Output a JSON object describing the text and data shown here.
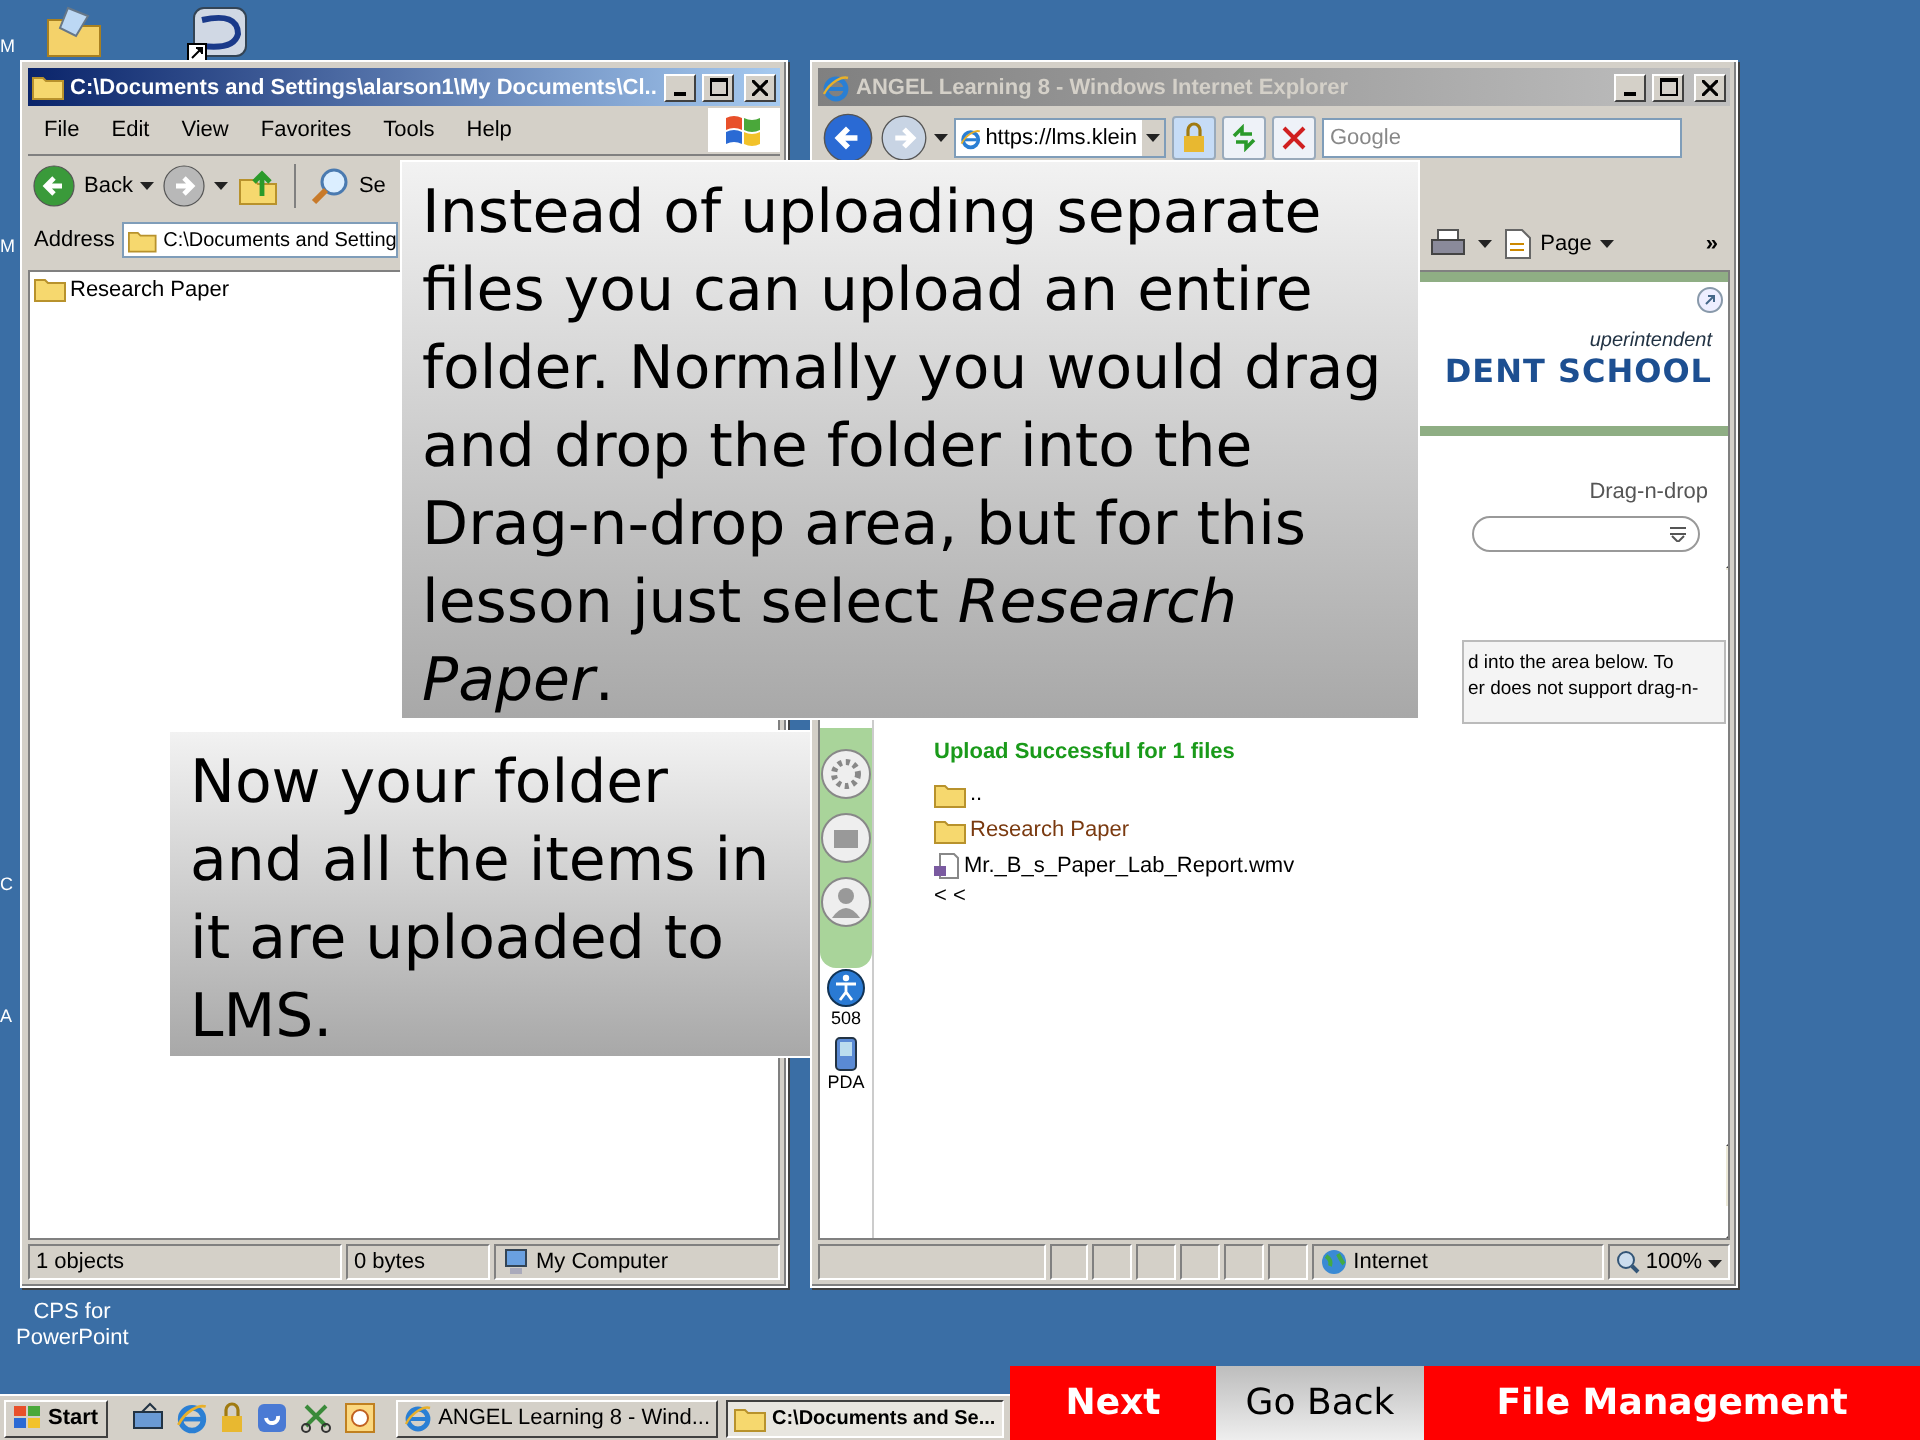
{
  "desktop": {
    "edge_labels": [
      {
        "label": "M"
      },
      {
        "label": "M"
      },
      {
        "label": "C"
      },
      {
        "label": "A"
      }
    ],
    "icons": [
      {
        "label": "CPS for PowerPoint"
      }
    ]
  },
  "explorer": {
    "title": "C:\\Documents and Settings\\alarson1\\My Documents\\Cl...",
    "active": true,
    "menu": [
      "File",
      "Edit",
      "View",
      "Favorites",
      "Tools",
      "Help"
    ],
    "toolbar": {
      "back": "Back",
      "search": "Se"
    },
    "address_label": "Address",
    "address": "C:\\Documents and Setting",
    "items": [
      {
        "name": "Research Paper"
      }
    ],
    "status_bar": [
      "1 objects",
      "0 bytes",
      "My Computer"
    ]
  },
  "browser": {
    "title": "ANGEL Learning 8 - Windows Internet Explorer",
    "active": false,
    "url": "https://lms.klein",
    "search": {
      "placeholder": "Google"
    },
    "command_bar": {
      "page": "Page",
      "more": "»"
    },
    "banner": {
      "subtitle": "uperintendent",
      "title": "DENT SCHOOL"
    },
    "breadcrumb": "Drag-n-drop",
    "directions": [
      "d into the area below. To",
      "er does not support drag-n-"
    ],
    "message": "Upload Successful for 1 files",
    "files": [
      {
        "kind": "folder",
        "name": ".."
      },
      {
        "kind": "folder",
        "name": "Research Paper"
      },
      {
        "kind": "video",
        "name": "Mr._B_s_Paper_Lab_Report.wmv"
      }
    ],
    "back_link": "< <",
    "rail_tools": [
      {
        "kind": "accessibility",
        "label": "508"
      },
      {
        "kind": "pda",
        "label": "PDA"
      }
    ],
    "status_bar": {
      "zone": "Internet",
      "zoom": "100%"
    }
  },
  "callouts": [
    {
      "text": "Instead of uploading separate files you can upload an entire folder. Normally you would drag and drop the folder into the Drag-n-drop area, but for this lesson just select *Research Paper*."
    },
    {
      "text": "Now your folder and all the items in it are uploaded to LMS."
    }
  ],
  "taskbar": {
    "start": "Start",
    "tasks": [
      {
        "kind": "browser",
        "label": "ANGEL Learning 8 - Wind...",
        "selected": false
      },
      {
        "kind": "folder",
        "label": "C:\\Documents and Se...",
        "selected": true
      }
    ]
  },
  "nav_buttons": [
    {
      "label": "Next",
      "kind": "primary"
    },
    {
      "label": "Go Back",
      "kind": "secondary"
    },
    {
      "label": "File Management",
      "kind": "primary"
    }
  ]
}
